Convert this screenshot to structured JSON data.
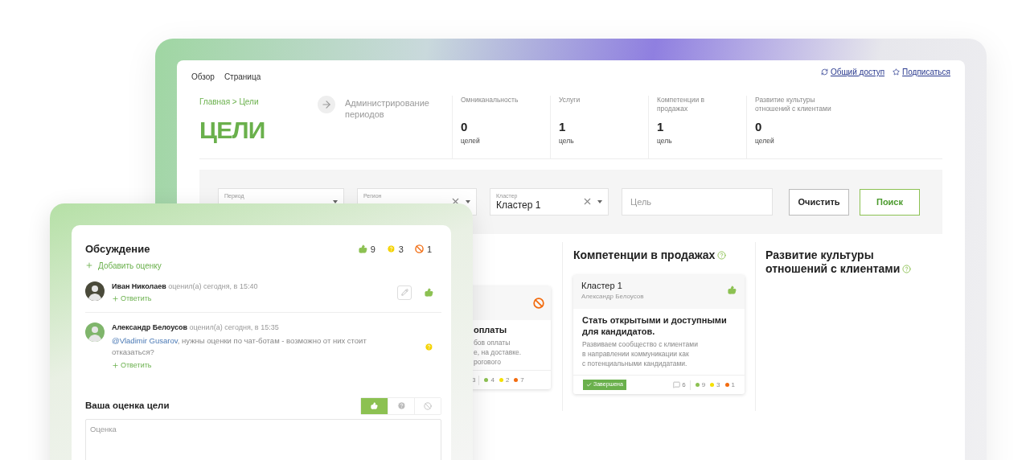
{
  "back_window": {
    "top_nav": [
      {
        "label": "Обзор"
      },
      {
        "label": "Страница"
      }
    ],
    "actions": [
      {
        "label": "Общий доступ",
        "kind": "share"
      },
      {
        "label": "Подписаться",
        "kind": "subscribe"
      }
    ],
    "breadcrumb": "Главная > Цели",
    "title": "ЦЕЛИ",
    "admin_link": "Администрирование периодов",
    "stats": [
      {
        "label": "Омниканальность",
        "value": "0",
        "unit": "целей"
      },
      {
        "label": "Услуги",
        "value": "1",
        "unit": "цель"
      },
      {
        "label": "Компетенции в продажах",
        "value": "1",
        "unit": "цель"
      },
      {
        "label": "Развитие культуры отношений с клиентами",
        "value": "0",
        "unit": "целей"
      }
    ],
    "filters": [
      {
        "kind": "select",
        "label": "Период",
        "clearable": false
      },
      {
        "kind": "select",
        "label": "Регион",
        "clearable": true
      },
      {
        "kind": "select",
        "label": "Кластер",
        "value": "Кластер 1",
        "clearable": true
      },
      {
        "kind": "text",
        "placeholder": "Цель"
      }
    ],
    "buttons": [
      {
        "label": "Очистить",
        "kind": "secondary"
      },
      {
        "label": "Поиск",
        "kind": "primary"
      }
    ],
    "columns": [
      {
        "cards": [
          {
            "kind": "partial",
            "rating": {
              "kind": "dislike"
            },
            "title": "оплаты",
            "description_lines": [
              "бов оплаты",
              "е, на доставке.",
              "рогового"
            ],
            "comments": "3",
            "likes": "4",
            "questions": "2",
            "dislikes": "7"
          }
        ]
      },
      {
        "title": "Компетенции в продажах",
        "cards": [
          {
            "kind": "full",
            "cluster": "Кластер 1",
            "author": "Александр Белоусов",
            "rating": {
              "kind": "like"
            },
            "title": "Стать открытыми и доступными для кандидатов.",
            "description_lines": [
              "Развиваем сообщество с клиентами",
              "в направлении коммуникации как",
              "с потенциальными кандидатами."
            ],
            "status": "Завершена",
            "comments": "6",
            "likes": "9",
            "questions": "3",
            "dislikes": "1"
          }
        ]
      },
      {
        "title": "Развитие культуры отношений с клиентами"
      }
    ]
  },
  "discussion": {
    "title": "Обсуждение",
    "counts": [
      {
        "kind": "like",
        "value": "9"
      },
      {
        "kind": "question",
        "value": "3"
      },
      {
        "kind": "dislike",
        "value": "1"
      }
    ],
    "add_label": "Добавить оценку",
    "comments": [
      {
        "author": "Иван Николаев",
        "meta": "оценил(а) сегодня, в 15:40",
        "editable": true,
        "rating": {
          "kind": "like"
        },
        "reply_label": "Ответить"
      },
      {
        "author": "Александр Белоусов",
        "meta": "оценил(а) сегодня, в 15:35",
        "mention": "@Vladimir Gusarov",
        "text": ", нужны оценки по чат-ботам - возможно от них стоит отказаться?",
        "editable": false,
        "rating": {
          "kind": "question"
        },
        "reply_label": "Ответить"
      }
    ],
    "your_rating": {
      "title": "Ваша оценка цели",
      "options": [
        {
          "kind": "like",
          "selected": true
        },
        {
          "kind": "question",
          "selected": false
        },
        {
          "kind": "dislike",
          "selected": false
        }
      ],
      "placeholder": "Оценка"
    }
  }
}
